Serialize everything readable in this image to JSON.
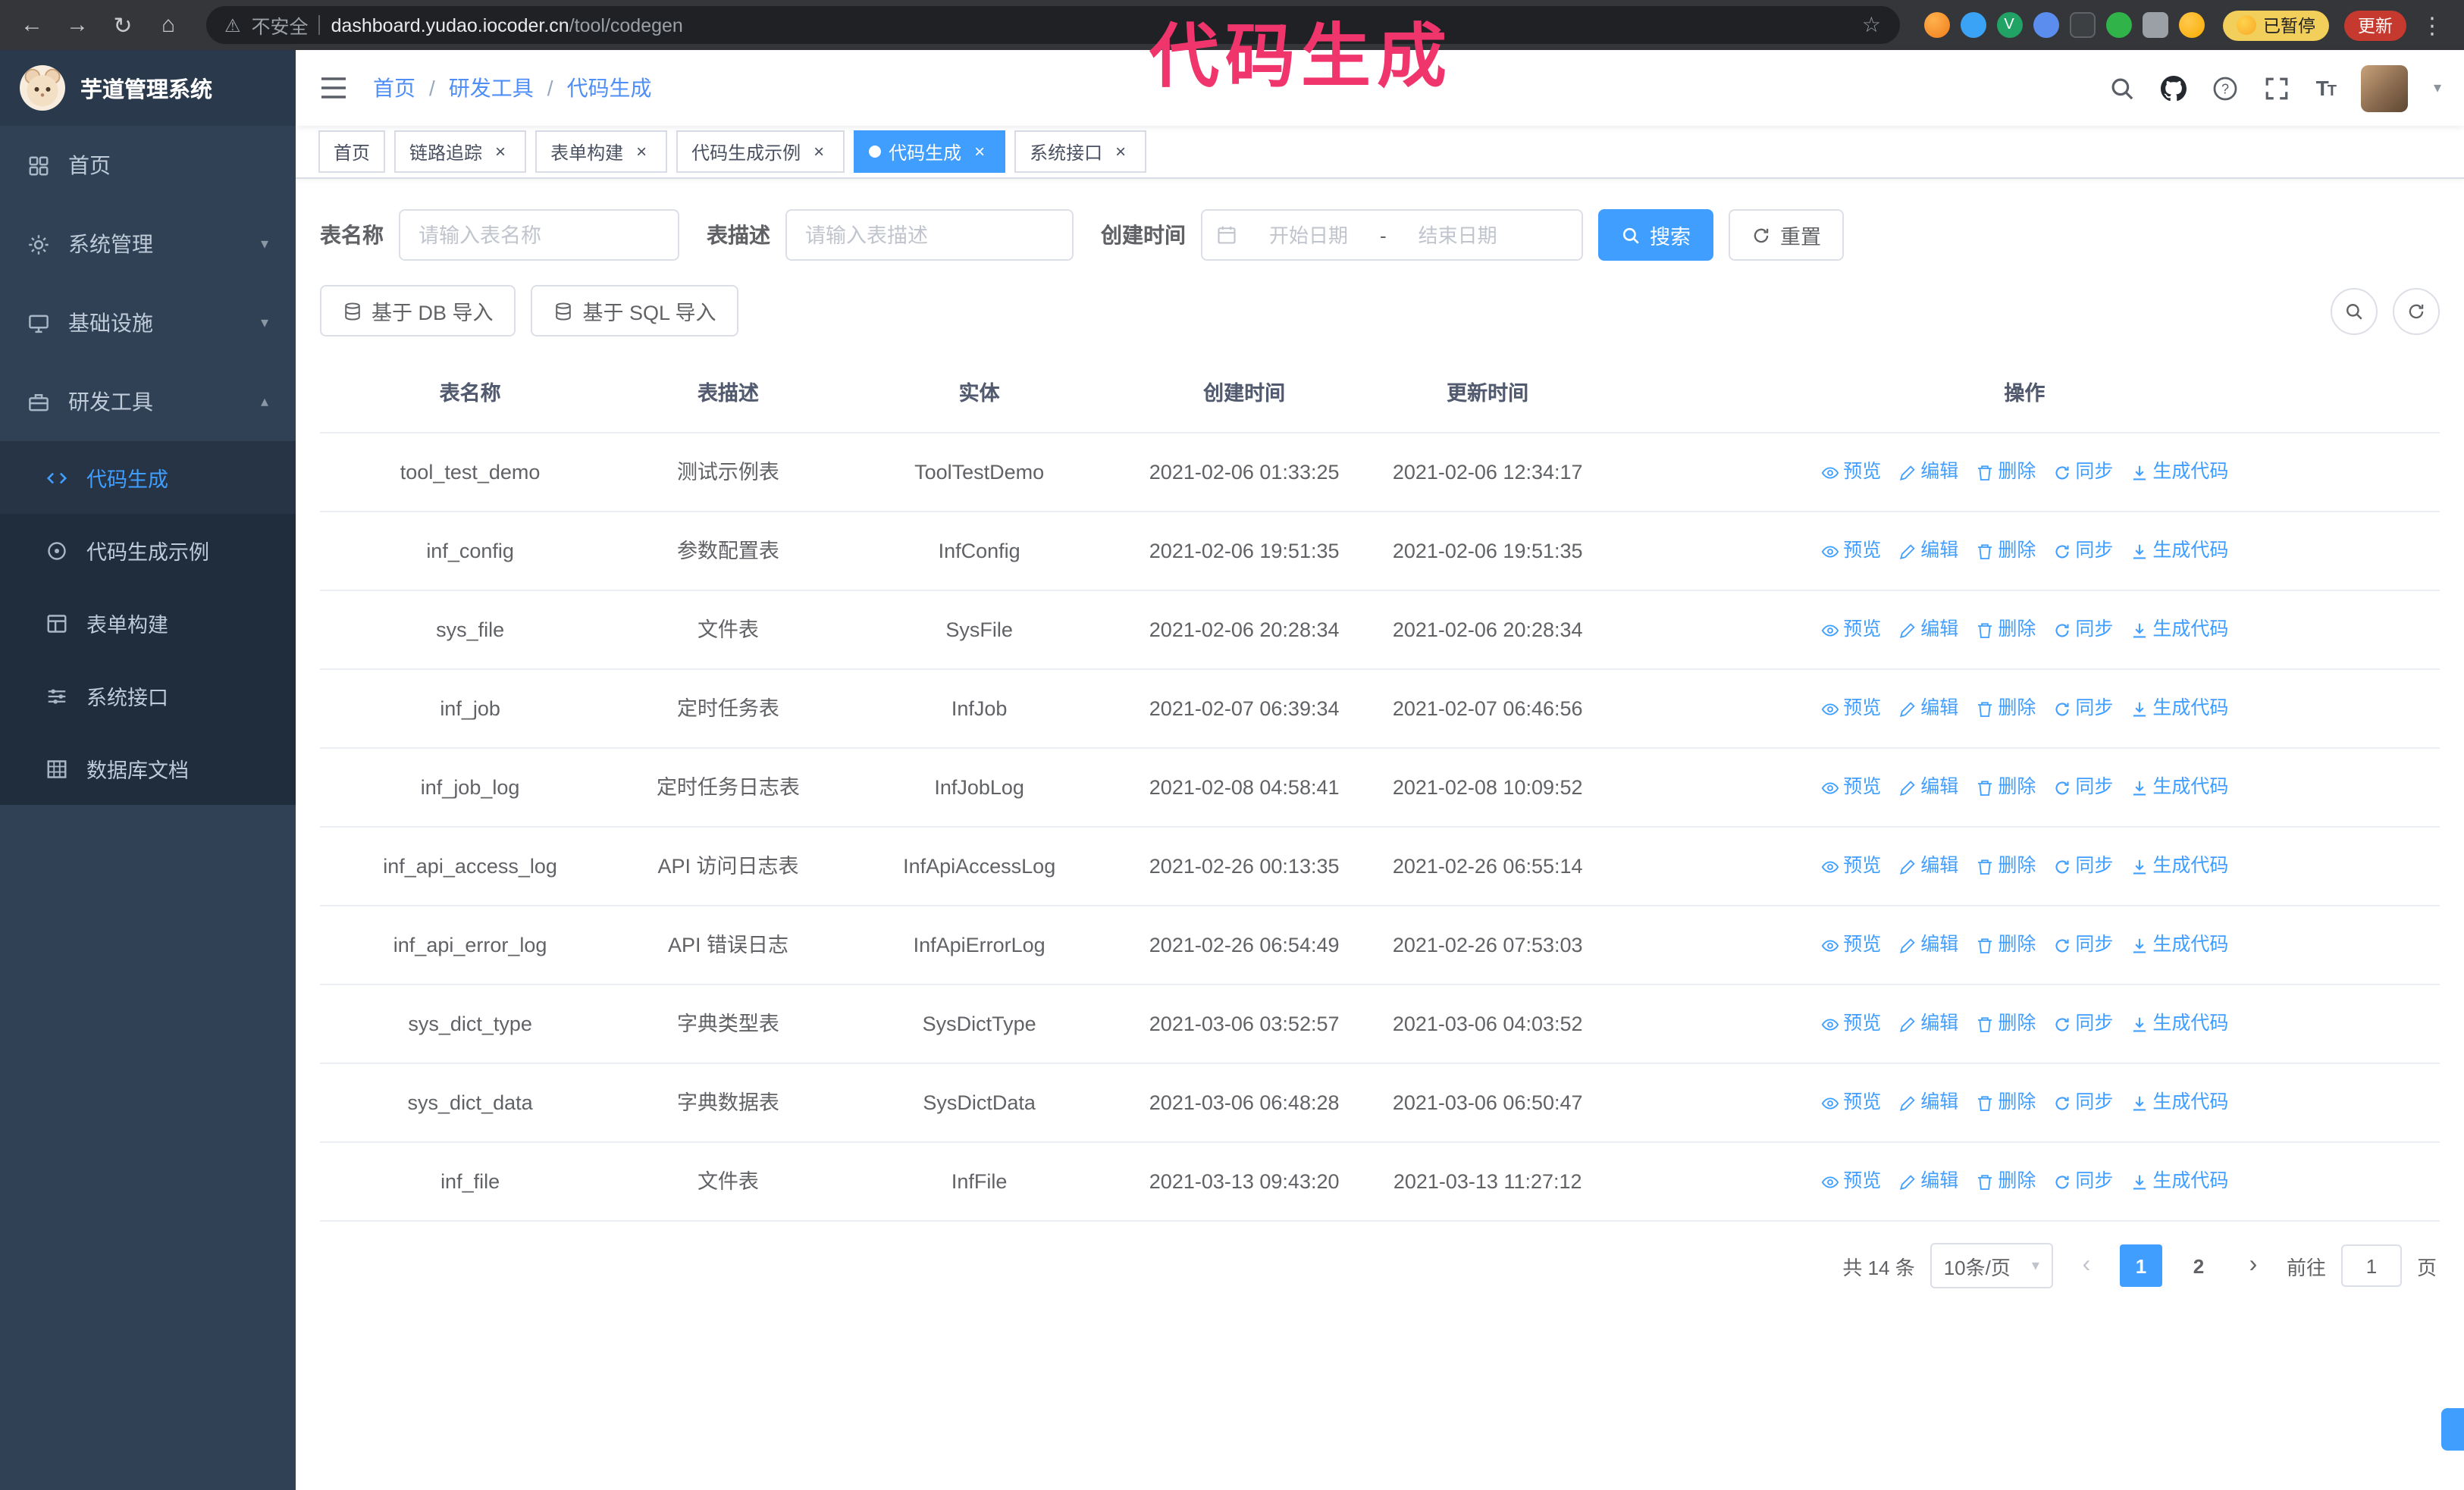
{
  "browser": {
    "security_label": "不安全",
    "url_domain": "dashboard.yudao.iocoder.cn",
    "url_path": "/tool/codegen",
    "paused_badge": "已暂停",
    "update_button": "更新"
  },
  "icons": {
    "back": "←",
    "forward": "→",
    "reload": "↻",
    "home": "⌂",
    "warning": "⚠",
    "star": "☆",
    "kebab": "⋮",
    "close": "×",
    "caret_down": "▾",
    "chev_down": "▾",
    "chev_up": "▴",
    "prev": "‹",
    "next": "›"
  },
  "annotation": {
    "text": "代码生成",
    "color": "#f0356d"
  },
  "sidebar": {
    "logo_title": "芋道管理系统",
    "items": [
      {
        "label": "首页",
        "icon": "dashboard-icon"
      },
      {
        "label": "系统管理",
        "icon": "gear-icon",
        "expandable": true
      },
      {
        "label": "基础设施",
        "icon": "monitor-icon",
        "expandable": true
      },
      {
        "label": "研发工具",
        "icon": "toolbox-icon",
        "expandable": true,
        "expanded": true
      }
    ],
    "sub_items": [
      {
        "label": "代码生成",
        "icon": "code-icon",
        "active": true
      },
      {
        "label": "代码生成示例",
        "icon": "target-icon"
      },
      {
        "label": "表单构建",
        "icon": "form-icon"
      },
      {
        "label": "系统接口",
        "icon": "sliders-icon"
      },
      {
        "label": "数据库文档",
        "icon": "grid-icon"
      }
    ]
  },
  "header": {
    "breadcrumb": [
      "首页",
      "研发工具",
      "代码生成"
    ],
    "sep": "/"
  },
  "tabs": [
    {
      "label": "首页",
      "closable": false
    },
    {
      "label": "链路追踪",
      "closable": true
    },
    {
      "label": "表单构建",
      "closable": true
    },
    {
      "label": "代码生成示例",
      "closable": true
    },
    {
      "label": "代码生成",
      "closable": true,
      "active": true
    },
    {
      "label": "系统接口",
      "closable": true
    }
  ],
  "filters": {
    "table_name_label": "表名称",
    "table_name_placeholder": "请输入表名称",
    "table_desc_label": "表描述",
    "table_desc_placeholder": "请输入表描述",
    "create_time_label": "创建时间",
    "date_start_placeholder": "开始日期",
    "date_separator": "-",
    "date_end_placeholder": "结束日期",
    "search_button": "搜索",
    "reset_button": "重置"
  },
  "toolbar": {
    "import_db_button": "基于 DB 导入",
    "import_sql_button": "基于 SQL 导入"
  },
  "table": {
    "columns": [
      "表名称",
      "表描述",
      "实体",
      "创建时间",
      "更新时间",
      "操作"
    ],
    "actions": [
      "预览",
      "编辑",
      "删除",
      "同步",
      "生成代码"
    ],
    "rows": [
      {
        "name": "tool_test_demo",
        "desc": "测试示例表",
        "entity": "ToolTestDemo",
        "created": "2021-02-06 01:33:25",
        "updated": "2021-02-06 12:34:17"
      },
      {
        "name": "inf_config",
        "desc": "参数配置表",
        "entity": "InfConfig",
        "created": "2021-02-06 19:51:35",
        "updated": "2021-02-06 19:51:35"
      },
      {
        "name": "sys_file",
        "desc": "文件表",
        "entity": "SysFile",
        "created": "2021-02-06 20:28:34",
        "updated": "2021-02-06 20:28:34"
      },
      {
        "name": "inf_job",
        "desc": "定时任务表",
        "entity": "InfJob",
        "created": "2021-02-07 06:39:34",
        "updated": "2021-02-07 06:46:56"
      },
      {
        "name": "inf_job_log",
        "desc": "定时任务日志表",
        "entity": "InfJobLog",
        "created": "2021-02-08 04:58:41",
        "updated": "2021-02-08 10:09:52"
      },
      {
        "name": "inf_api_access_log",
        "desc": "API 访问日志表",
        "entity": "InfApiAccessLog",
        "created": "2021-02-26 00:13:35",
        "updated": "2021-02-26 06:55:14"
      },
      {
        "name": "inf_api_error_log",
        "desc": "API 错误日志",
        "entity": "InfApiErrorLog",
        "created": "2021-02-26 06:54:49",
        "updated": "2021-02-26 07:53:03"
      },
      {
        "name": "sys_dict_type",
        "desc": "字典类型表",
        "entity": "SysDictType",
        "created": "2021-03-06 03:52:57",
        "updated": "2021-03-06 04:03:52"
      },
      {
        "name": "sys_dict_data",
        "desc": "字典数据表",
        "entity": "SysDictData",
        "created": "2021-03-06 06:48:28",
        "updated": "2021-03-06 06:50:47"
      },
      {
        "name": "inf_file",
        "desc": "文件表",
        "entity": "InfFile",
        "created": "2021-03-13 09:43:20",
        "updated": "2021-03-13 11:27:12"
      }
    ]
  },
  "pagination": {
    "total_text": "共 14 条",
    "page_size": "10条/页",
    "pages": [
      "1",
      "2"
    ],
    "active_page": "1",
    "jump_prefix": "前往",
    "jump_value": "1",
    "jump_suffix": "页"
  },
  "colors": {
    "accent": "#409eff",
    "annotation": "#f0356d",
    "sidebar_bg": "#304156",
    "submenu_bg": "#1f2d3d"
  }
}
